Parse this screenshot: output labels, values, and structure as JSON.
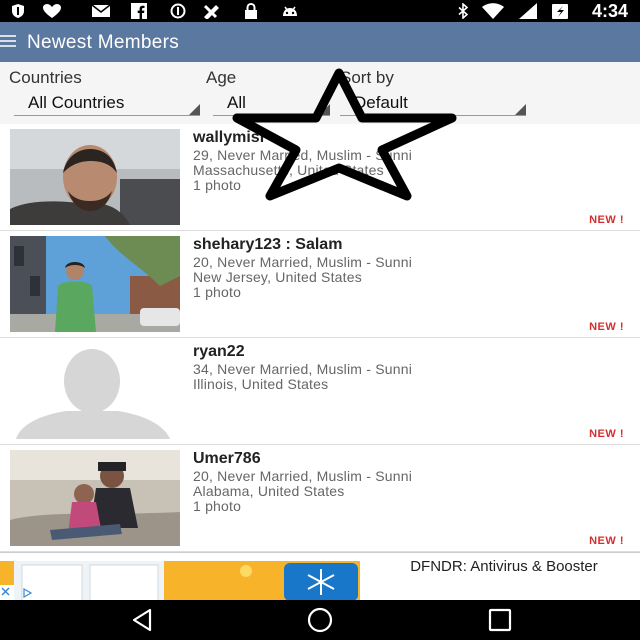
{
  "status_bar": {
    "time": "4:34",
    "icons": [
      "shield-icon",
      "heart-icon",
      "mail-icon",
      "facebook-icon",
      "sync-icon",
      "tools-icon",
      "lock-icon",
      "android-icon",
      "bluetooth-icon",
      "wifi-icon",
      "battery-icon"
    ]
  },
  "app_bar": {
    "title": "Newest Members"
  },
  "filters": {
    "countries": {
      "label": "Countries",
      "value": "All Countries"
    },
    "age": {
      "label": "Age",
      "value": "All"
    },
    "sort": {
      "label": "Sort by",
      "value": "Default"
    }
  },
  "members": [
    {
      "name": "wallymisr",
      "details": "29, Never Married, Muslim - Sunni",
      "location": "Massachusetts, United States",
      "photos": "1 photo",
      "badge": "NEW !"
    },
    {
      "name": "shehary123 : Salam",
      "details": "20, Never Married, Muslim - Sunni",
      "location": "New Jersey, United States",
      "photos": "1 photo",
      "badge": "NEW !"
    },
    {
      "name": "ryan22",
      "details": "34, Never Married, Muslim - Sunni",
      "location": "Illinois, United States",
      "photos": "",
      "badge": "NEW !"
    },
    {
      "name": "Umer786",
      "details": "20, Never Married, Muslim - Sunni",
      "location": "Alabama, United States",
      "photos": "1 photo",
      "badge": "NEW !"
    }
  ],
  "ad": {
    "title": "DFNDR: Antivirus & Booster"
  },
  "nav": {
    "icons": [
      "back-icon",
      "home-icon",
      "recents-icon"
    ]
  },
  "colors": {
    "app_bar": "#5a78a0",
    "badge": "#d32f2f"
  }
}
